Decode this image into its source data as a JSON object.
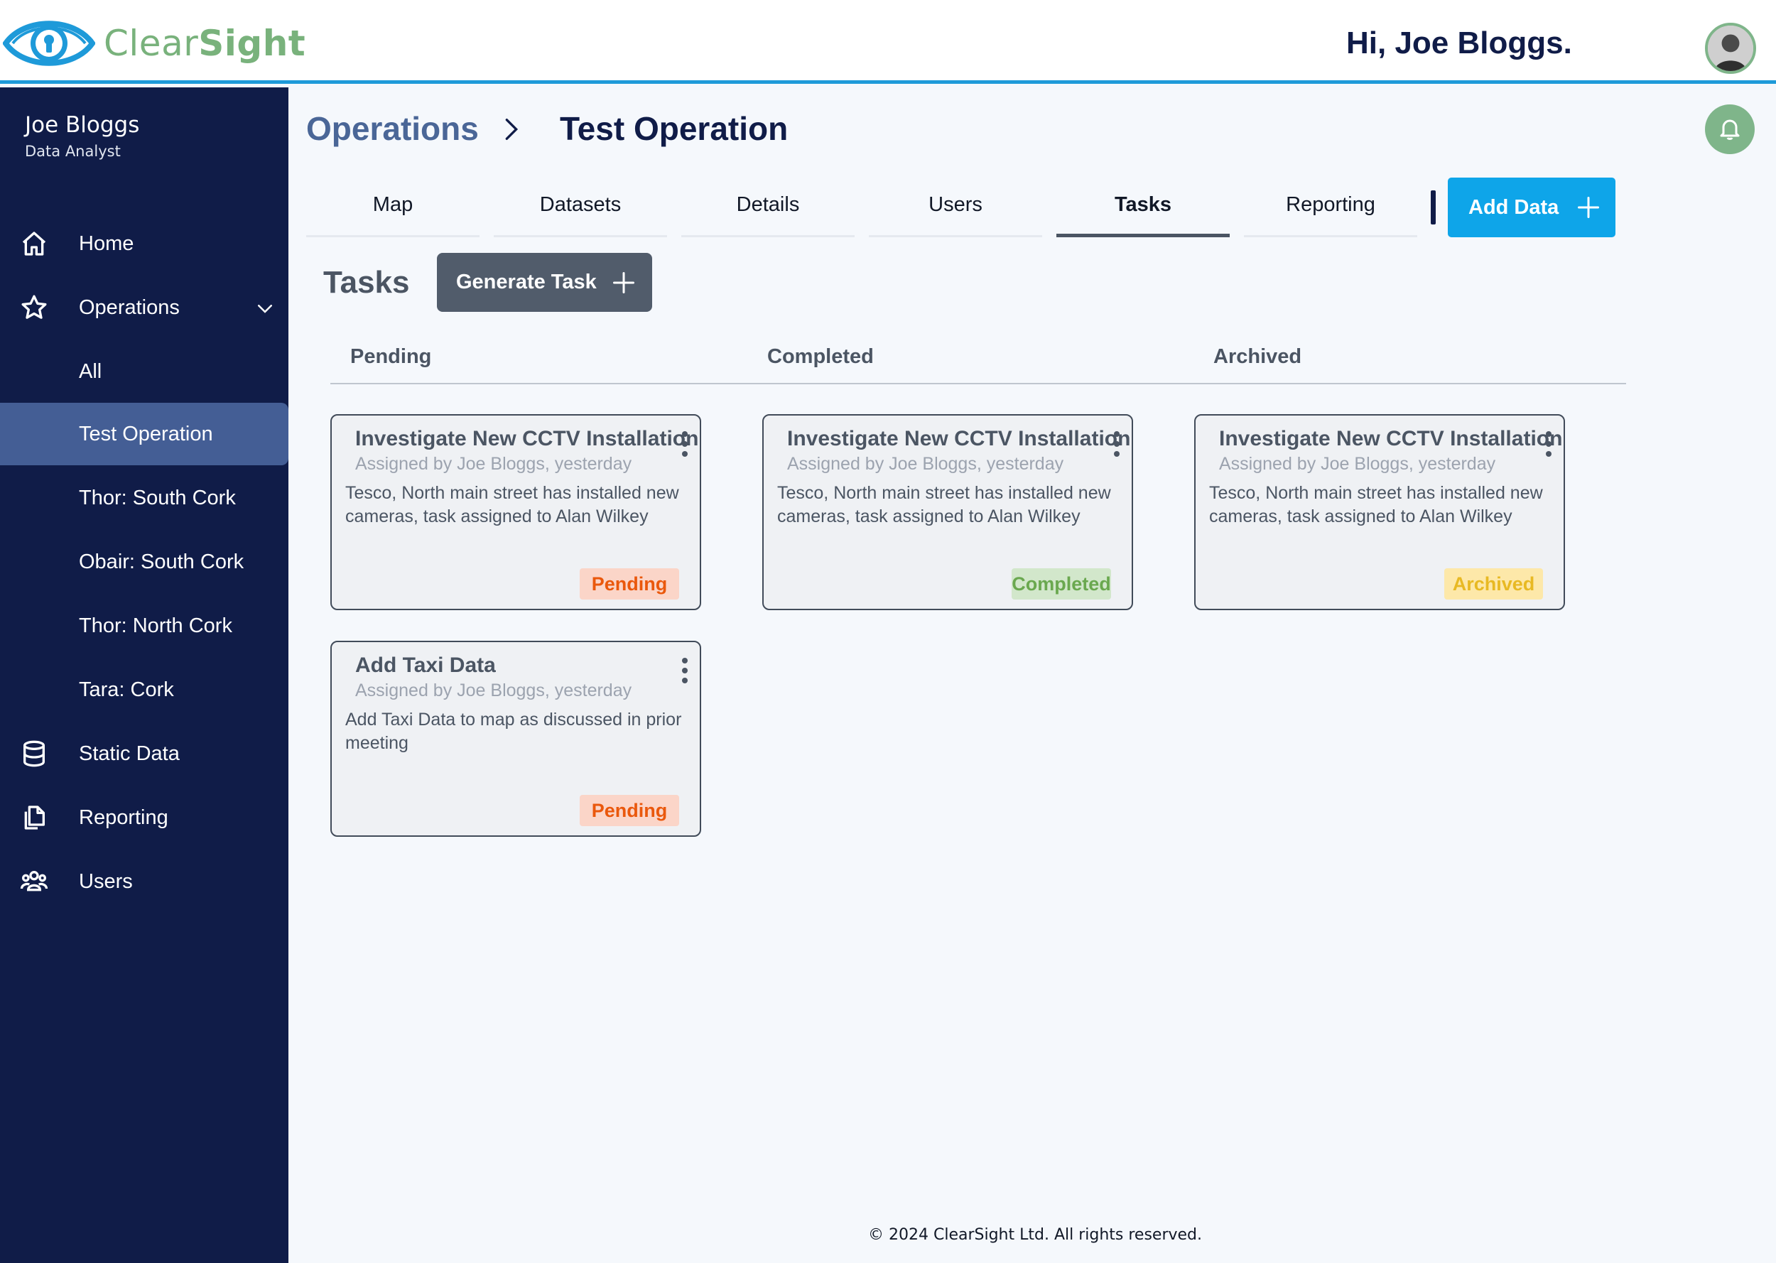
{
  "header": {
    "logo_clear": "Clear",
    "logo_sight": "Sight",
    "greeting": "Hi, Joe Bloggs."
  },
  "sidebar": {
    "user_name": "Joe Bloggs",
    "user_role": "Data Analyst",
    "items": [
      {
        "label": "Home",
        "icon": "home-icon"
      },
      {
        "label": "Operations",
        "icon": "star-icon"
      },
      {
        "label": "All"
      },
      {
        "label": "Test Operation",
        "active": true
      },
      {
        "label": "Thor: South Cork"
      },
      {
        "label": "Obair: South Cork"
      },
      {
        "label": "Thor: North Cork"
      },
      {
        "label": "Tara: Cork"
      },
      {
        "label": "Static Data",
        "icon": "database-icon"
      },
      {
        "label": "Reporting",
        "icon": "documents-icon"
      },
      {
        "label": "Users",
        "icon": "users-icon"
      }
    ]
  },
  "breadcrumb": {
    "root": "Operations",
    "current": "Test Operation"
  },
  "tabs": [
    {
      "label": "Map"
    },
    {
      "label": "Datasets"
    },
    {
      "label": "Details"
    },
    {
      "label": "Users"
    },
    {
      "label": "Tasks",
      "active": true
    },
    {
      "label": "Reporting"
    }
  ],
  "actions": {
    "add_data": "Add Data",
    "generate_task": "Generate Task"
  },
  "tasks": {
    "title": "Tasks",
    "columns": [
      "Pending",
      "Completed",
      "Archived"
    ],
    "cards": [
      {
        "title": "Investigate New CCTV Installation",
        "subtitle": "Assigned by Joe Bloggs, yesterday",
        "description": "Tesco, North main street has installed new cameras, task assigned to Alan Wilkey",
        "status": "Pending"
      },
      {
        "title": "Investigate New CCTV Installation",
        "subtitle": "Assigned by Joe Bloggs, yesterday",
        "description": "Tesco, North main street has installed new cameras, task assigned to Alan Wilkey",
        "status": "Completed"
      },
      {
        "title": "Investigate New CCTV Installation",
        "subtitle": "Assigned by Joe Bloggs, yesterday",
        "description": "Tesco, North main street has installed new cameras, task assigned to Alan Wilkey",
        "status": "Archived"
      },
      {
        "title": "Add Taxi Data",
        "subtitle": "Assigned by Joe Bloggs, yesterday",
        "description": "Add Taxi Data to map as discussed in prior meeting",
        "status": "Pending"
      }
    ]
  },
  "footer": "© 2024 ClearSight Ltd. All rights reserved.",
  "colors": {
    "sidebar_bg": "#101c48",
    "active_nav": "#445e95",
    "accent_blue": "#0ea5e9",
    "header_border": "#1e9ad9",
    "brand_green": "#79b27c",
    "pending": "#ea580c",
    "completed": "#6aa84f",
    "archived": "#e8b923"
  }
}
